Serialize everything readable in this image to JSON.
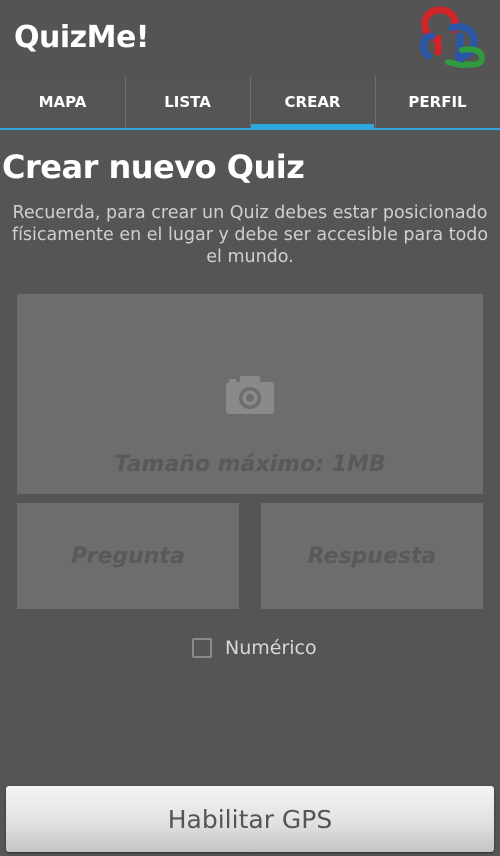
{
  "app": {
    "title": "QuizMe!",
    "logo_icon": "quizme-logo-icon"
  },
  "tabs": [
    {
      "label": "MAPA",
      "selected": false
    },
    {
      "label": "LISTA",
      "selected": false
    },
    {
      "label": "CREAR",
      "selected": true
    },
    {
      "label": "PERFIL",
      "selected": false
    }
  ],
  "main": {
    "title": "Crear nuevo Quiz",
    "description": "Recuerda, para crear un Quiz debes estar posicionado físicamente en el lugar y debe ser accesible para todo el mundo.",
    "photo": {
      "icon": "camera-icon",
      "hint": "Tamaño máximo: 1MB"
    },
    "question_placeholder": "Pregunta",
    "answer_placeholder": "Respuesta",
    "numeric": {
      "label": "Numérico",
      "checked": false
    },
    "gps_button_label": "Habilitar GPS"
  },
  "colors": {
    "background": "#555555",
    "accent": "#2ea7dd",
    "field": "#6d6d6d"
  }
}
